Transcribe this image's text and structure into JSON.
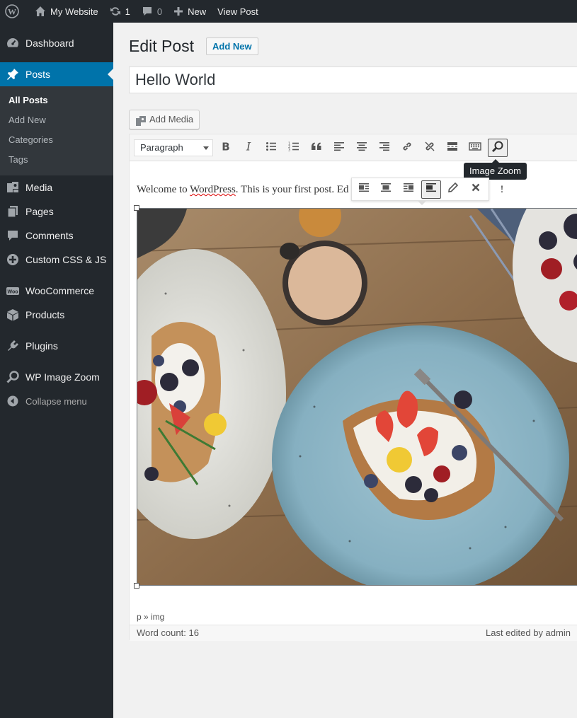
{
  "admin_bar": {
    "site_name": "My Website",
    "updates_count": "1",
    "comments_count": "0",
    "new_label": "New",
    "view_post_label": "View Post"
  },
  "sidebar": {
    "items": [
      {
        "label": "Dashboard",
        "icon": "dashboard-icon"
      },
      {
        "label": "Posts",
        "icon": "pin-icon"
      },
      {
        "label": "Media",
        "icon": "media-icon"
      },
      {
        "label": "Pages",
        "icon": "pages-icon"
      },
      {
        "label": "Comments",
        "icon": "comment-icon"
      },
      {
        "label": "Custom CSS & JS",
        "icon": "plus-circle-icon"
      },
      {
        "label": "WooCommerce",
        "icon": "woo-icon"
      },
      {
        "label": "Products",
        "icon": "box-icon"
      },
      {
        "label": "Plugins",
        "icon": "plugin-icon"
      },
      {
        "label": "WP Image Zoom",
        "icon": "search-icon"
      },
      {
        "label": "Collapse menu",
        "icon": "collapse-icon"
      }
    ],
    "posts_submenu": [
      "All Posts",
      "Add New",
      "Categories",
      "Tags"
    ]
  },
  "main": {
    "page_title": "Edit Post",
    "add_new_label": "Add New",
    "post_title": "Hello World",
    "add_media_label": "Add Media",
    "format_select": "Paragraph",
    "tooltip": "Image Zoom",
    "paragraph_start": "Welcome to ",
    "paragraph_squiggle": "WordPress",
    "paragraph_mid": ". This is your first post. Ed",
    "paragraph_end": "!",
    "path": "p » img",
    "word_count": "Word count: 16",
    "last_edited": "Last edited by admin"
  },
  "colors": {
    "admin_dark": "#23282d",
    "accent": "#0073aa",
    "submenu_bg": "#32373c"
  }
}
